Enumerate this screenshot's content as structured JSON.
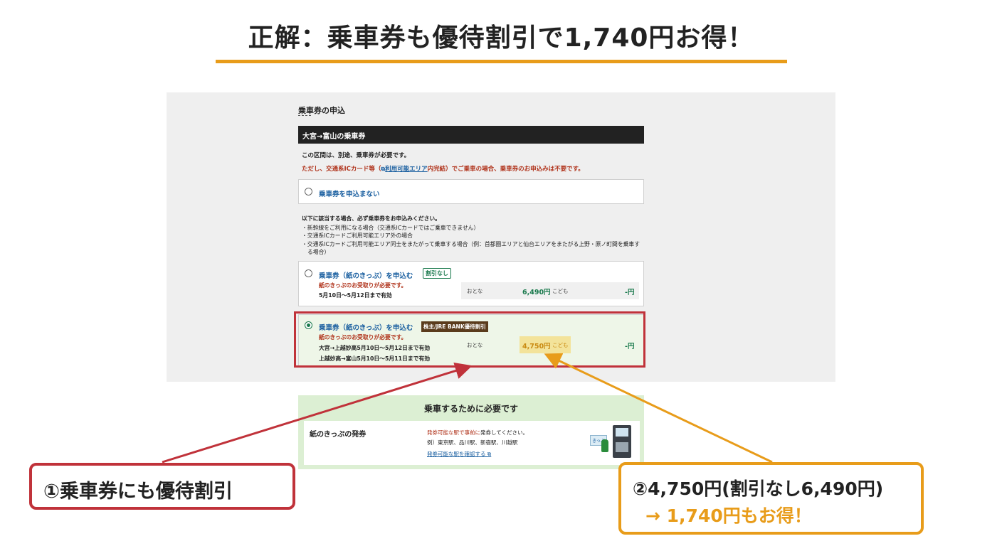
{
  "headline": "正解：乗車券も優待割引で1,740円お得！",
  "form": {
    "title": "乗車券の申込",
    "section": "大宮→富山の乗車券",
    "note1": "この区間は、別途、乗車券が必要です。",
    "note2_pre": "ただし、交通系ICカード等（",
    "note2_link": "利用可能エリア",
    "note2_post": "内完結）でご乗車の場合、乗車券のお申込みは不要です。",
    "option_none_label": "乗車券を申込まない",
    "conditions_lead": "以下に該当する場合、必ず乗車券をお申込みください。",
    "conditions": [
      "・新幹線をご利用になる場合（交通系ICカードではご乗車できません）",
      "・交通系ICカードご利用可能エリア外の場合",
      "・交通系ICカードご利用可能エリア同士をまたがって乗車する場合（例：首都圏エリアと仙台エリアをまたがる上野・原ノ町間を乗車する場合）"
    ],
    "option_regular": {
      "label": "乗車券（紙のきっぷ）を申込む",
      "badge": "割引なし",
      "pickup": "紙のきっぷのお受取りが必要です。",
      "validity": "5月10日〜5月12日まで有効",
      "adult_label": "おとな",
      "adult_price": "6,490円",
      "child_label": "こども",
      "child_price": "-円"
    },
    "option_discount": {
      "label": "乗車券（紙のきっぷ）を申込む",
      "badge": "株主/JRE BANK優待割引",
      "pickup": "紙のきっぷのお受取りが必要です。",
      "validity1": "大宮→上越妙高5月10日〜5月12日まで有効",
      "validity2": "上越妙高→富山5月10日〜5月11日まで有効",
      "adult_label": "おとな",
      "adult_price": "4,750円",
      "child_label": "こども",
      "child_price": "-円",
      "selected": true
    }
  },
  "need_panel": {
    "title": "乗車するために必要です",
    "item": "紙のきっぷの発券",
    "desc1_red": "発券可能な駅で事前に",
    "desc1_rest": "発券してください。",
    "desc2": "例）東京駅、品川駅、新宿駅、川越駅",
    "link": "発券可能な駅を確認する",
    "kippu_tag": "きっぷ"
  },
  "callouts": {
    "left": "①乗車券にも優待割引",
    "right_line1": "②4,750円(割引なし6,490円)",
    "right_line2": "→ 1,740円もお得！"
  },
  "colors": {
    "accent_orange": "#e89c1a",
    "accent_red": "#c0323a",
    "jr_green": "#19794c"
  }
}
